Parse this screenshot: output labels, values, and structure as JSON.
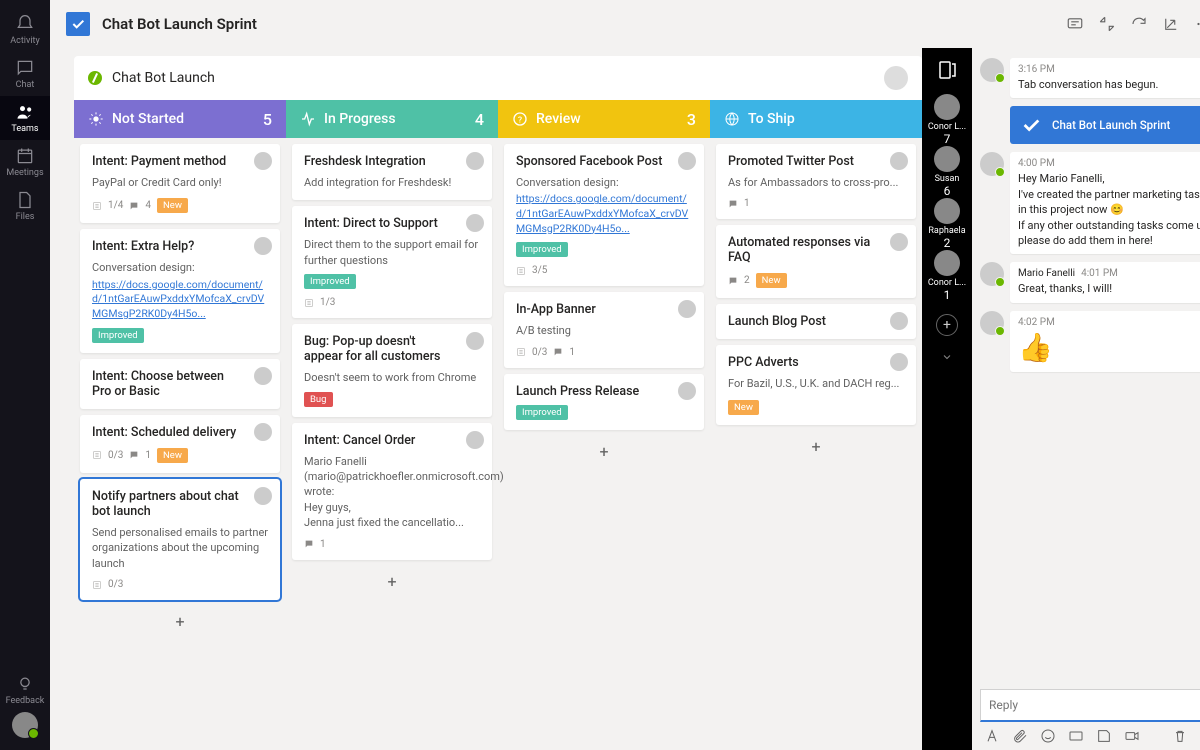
{
  "rail": {
    "activity": "Activity",
    "chat": "Chat",
    "teams": "Teams",
    "meetings": "Meetings",
    "files": "Files",
    "feedback": "Feedback"
  },
  "topbar": {
    "title": "Chat Bot Launch Sprint"
  },
  "board": {
    "title": "Chat Bot Launch"
  },
  "columns": [
    {
      "name": "Not Started",
      "count": "5",
      "color": "#7c6fd1",
      "cards": [
        {
          "title": "Intent: Payment method",
          "desc": "PayPal or Credit Card only!",
          "sub": "1/4",
          "comments": "4",
          "tag": "New"
        },
        {
          "title": "Intent: Extra Help?",
          "desc": "Conversation design:",
          "link": "https://docs.google.com/document/d/1ntGarEAuwPxddxYMofcaX_crvDVMGMsgP2RK0Dy4H5o...",
          "tag2": "Improved"
        },
        {
          "title": "Intent: Choose between Pro or Basic"
        },
        {
          "title": "Intent: Scheduled delivery",
          "sub": "0/3",
          "comments": "1",
          "tag": "New"
        },
        {
          "title": "Notify partners about chat bot launch",
          "desc": "Send personalised emails to partner organizations about the upcoming launch",
          "sub": "0/3",
          "selected": true
        }
      ]
    },
    {
      "name": "In Progress",
      "count": "4",
      "color": "#4fc1a6",
      "cards": [
        {
          "title": "Freshdesk Integration",
          "desc": "Add integration for Freshdesk!"
        },
        {
          "title": "Intent: Direct to Support",
          "desc": "Direct them to the support email for further questions",
          "sub": "1/3",
          "tag2": "Improved"
        },
        {
          "title": "Bug: Pop-up doesn't appear for all customers",
          "desc": "Doesn't seem to work from Chrome",
          "tag2": "Bug"
        },
        {
          "title": "Intent: Cancel Order",
          "desc": "Mario Fanelli (mario@patrickhoefler.onmicrosoft.com) wrote:\nHey guys,\nJenna just fixed the cancellatio...",
          "comments": "1"
        }
      ]
    },
    {
      "name": "Review",
      "count": "3",
      "color": "#f1c40f",
      "cards": [
        {
          "title": "Sponsored Facebook Post",
          "desc": "Conversation design:",
          "link": "https://docs.google.com/document/d/1ntGarEAuwPxddxYMofcaX_crvDVMGMsgP2RK0Dy4H5o...",
          "sub": "3/5",
          "tag2": "Improved"
        },
        {
          "title": "In-App Banner",
          "desc": "A/B testing",
          "sub": "0/3",
          "comments": "1"
        },
        {
          "title": "Launch Press Release",
          "tag2": "Improved"
        }
      ]
    },
    {
      "name": "To Ship",
      "count": "",
      "color": "#3cb4e5",
      "cards": [
        {
          "title": "Promoted Twitter Post",
          "desc": "As for Ambassadors to cross-pro...",
          "comments": "1"
        },
        {
          "title": "Automated responses via FAQ",
          "comments": "2",
          "tag": "New"
        },
        {
          "title": "Launch Blog Post"
        },
        {
          "title": "PPC Adverts",
          "desc": "For Bazil, U.S., U.K. and DACH reg...",
          "tag": "New"
        }
      ]
    }
  ],
  "members": [
    {
      "name": "Conor L...",
      "count": "7"
    },
    {
      "name": "Susan",
      "count": "6"
    },
    {
      "name": "Raphaela",
      "count": "2"
    },
    {
      "name": "Conor L...",
      "count": "1"
    }
  ],
  "chat": {
    "messages": [
      {
        "type": "text",
        "time": "3:16 PM",
        "body": "Tab conversation has begun."
      },
      {
        "type": "banner",
        "text": "Chat Bot Launch Sprint"
      },
      {
        "type": "text",
        "time": "4:00 PM",
        "body": "Hey Mario Fanelli,\nI've created the partner marketing task in this project now 😊\nIf any other outstanding tasks come up, please do add them in here!"
      },
      {
        "type": "text",
        "author": "Mario Fanelli",
        "time": "4:01 PM",
        "body": "Great, thanks, I will!"
      },
      {
        "type": "emoji",
        "time": "4:02 PM",
        "body": "👍"
      }
    ],
    "reply_placeholder": "Reply"
  }
}
